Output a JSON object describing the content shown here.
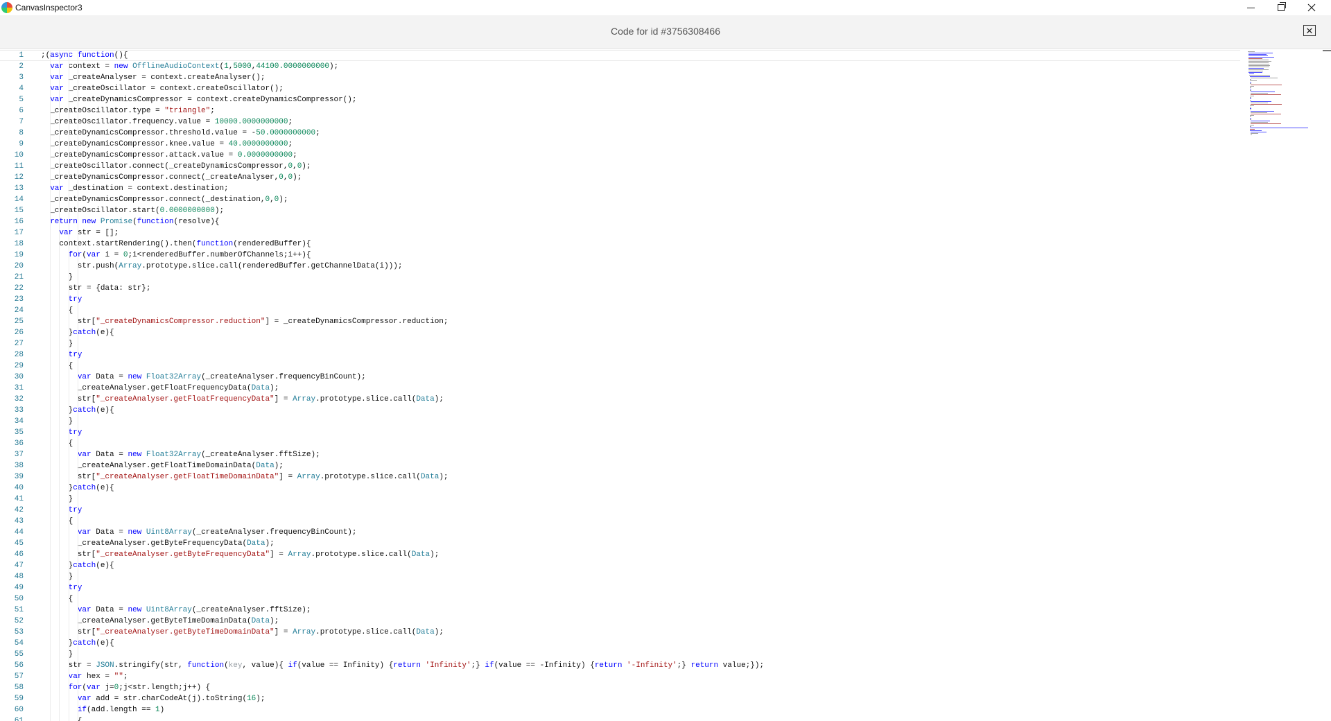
{
  "window": {
    "title": "CanvasInspector3",
    "minimize_icon": "minimize-icon",
    "maximize_icon": "restore-icon",
    "close_icon": "close-icon"
  },
  "header": {
    "title": "Code for id #3756308466",
    "close_icon": "close-box-icon",
    "close_glyph": "✕"
  },
  "colors": {
    "keyword": "#0000ff",
    "type": "#267f99",
    "number": "#098658",
    "string": "#a31515",
    "param": "#9aa0a6",
    "text": "#111111",
    "line_number": "#237893"
  },
  "editor": {
    "lines": [
      ";(async function(){",
      "  var context = new OfflineAudioContext(1,5000,44100.0000000000);",
      "  var _createAnalyser = context.createAnalyser();",
      "  var _createOscillator = context.createOscillator();",
      "  var _createDynamicsCompressor = context.createDynamicsCompressor();",
      "  _createOscillator.type = \"triangle\";",
      "  _createOscillator.frequency.value = 10000.0000000000;",
      "  _createDynamicsCompressor.threshold.value = -50.0000000000;",
      "  _createDynamicsCompressor.knee.value = 40.0000000000;",
      "  _createDynamicsCompressor.attack.value = 0.0000000000;",
      "  _createOscillator.connect(_createDynamicsCompressor,0,0);",
      "  _createDynamicsCompressor.connect(_createAnalyser,0,0);",
      "  var _destination = context.destination;",
      "  _createDynamicsCompressor.connect(_destination,0,0);",
      "  _createOscillator.start(0.0000000000);",
      "  return new Promise(function(resolve){",
      "    var str = [];",
      "    context.startRendering().then(function(renderedBuffer){",
      "      for(var i = 0;i<renderedBuffer.numberOfChannels;i++){",
      "        str.push(Array.prototype.slice.call(renderedBuffer.getChannelData(i)));",
      "      }",
      "      str = {data: str};",
      "      try",
      "      {",
      "        str[\"_createDynamicsCompressor.reduction\"] = _createDynamicsCompressor.reduction;",
      "      }catch(e){",
      "      }",
      "      try",
      "      {",
      "        var Data = new Float32Array(_createAnalyser.frequencyBinCount);",
      "        _createAnalyser.getFloatFrequencyData(Data);",
      "        str[\"_createAnalyser.getFloatFrequencyData\"] = Array.prototype.slice.call(Data);",
      "      }catch(e){",
      "      }",
      "      try",
      "      {",
      "        var Data = new Float32Array(_createAnalyser.fftSize);",
      "        _createAnalyser.getFloatTimeDomainData(Data);",
      "        str[\"_createAnalyser.getFloatTimeDomainData\"] = Array.prototype.slice.call(Data);",
      "      }catch(e){",
      "      }",
      "      try",
      "      {",
      "        var Data = new Uint8Array(_createAnalyser.frequencyBinCount);",
      "        _createAnalyser.getByteFrequencyData(Data);",
      "        str[\"_createAnalyser.getByteFrequencyData\"] = Array.prototype.slice.call(Data);",
      "      }catch(e){",
      "      }",
      "      try",
      "      {",
      "        var Data = new Uint8Array(_createAnalyser.fftSize);",
      "        _createAnalyser.getByteTimeDomainData(Data);",
      "        str[\"_createAnalyser.getByteTimeDomainData\"] = Array.prototype.slice.call(Data);",
      "      }catch(e){",
      "      }",
      "      str = JSON.stringify(str, function(key, value){ if(value == Infinity) {return 'Infinity';} if(value == -Infinity) {return '-Infinity';} return value;});",
      "      var hex = \"\";",
      "      for(var j=0;j<str.length;j++) {",
      "        var add = str.charCodeAt(j).toString(16);",
      "        if(add.length == 1)",
      "        {"
    ]
  }
}
